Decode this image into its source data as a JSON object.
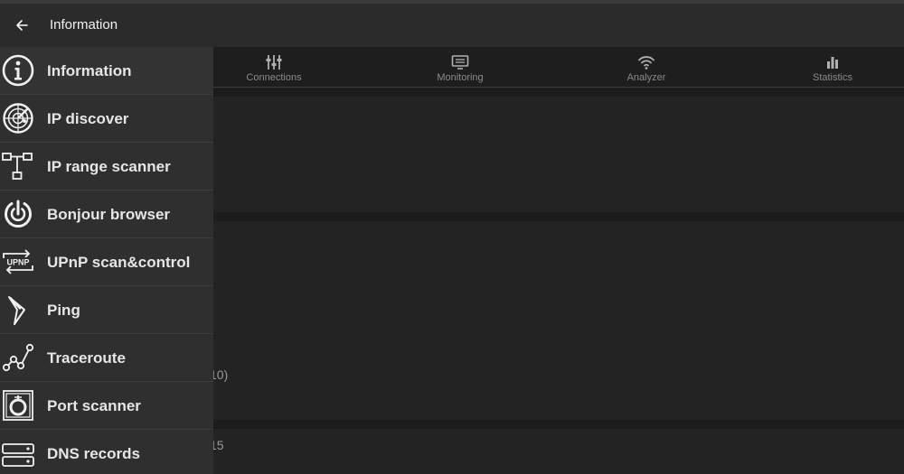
{
  "appbar": {
    "title": "Information"
  },
  "tabs": [
    {
      "label": "Connections",
      "icon": "connections-icon"
    },
    {
      "label": "Monitoring",
      "icon": "monitor-icon"
    },
    {
      "label": "Analyzer",
      "icon": "wifi-icon"
    },
    {
      "label": "Statistics",
      "icon": "bar-chart-icon"
    }
  ],
  "drawer": {
    "items": [
      {
        "label": "Information",
        "icon": "info-icon"
      },
      {
        "label": "IP discover",
        "icon": "radar-icon"
      },
      {
        "label": "IP range scanner",
        "icon": "network-tree-icon"
      },
      {
        "label": "Bonjour browser",
        "icon": "bonjour-icon"
      },
      {
        "label": "UPnP scan&control",
        "icon": "upnp-icon"
      },
      {
        "label": "Ping",
        "icon": "ping-icon"
      },
      {
        "label": "Traceroute",
        "icon": "traceroute-icon"
      },
      {
        "label": "Port scanner",
        "icon": "port-scanner-icon"
      },
      {
        "label": "DNS records",
        "icon": "dns-icon"
      }
    ]
  },
  "content": {
    "partial_text_1": "10)",
    "partial_text_2": "15"
  }
}
